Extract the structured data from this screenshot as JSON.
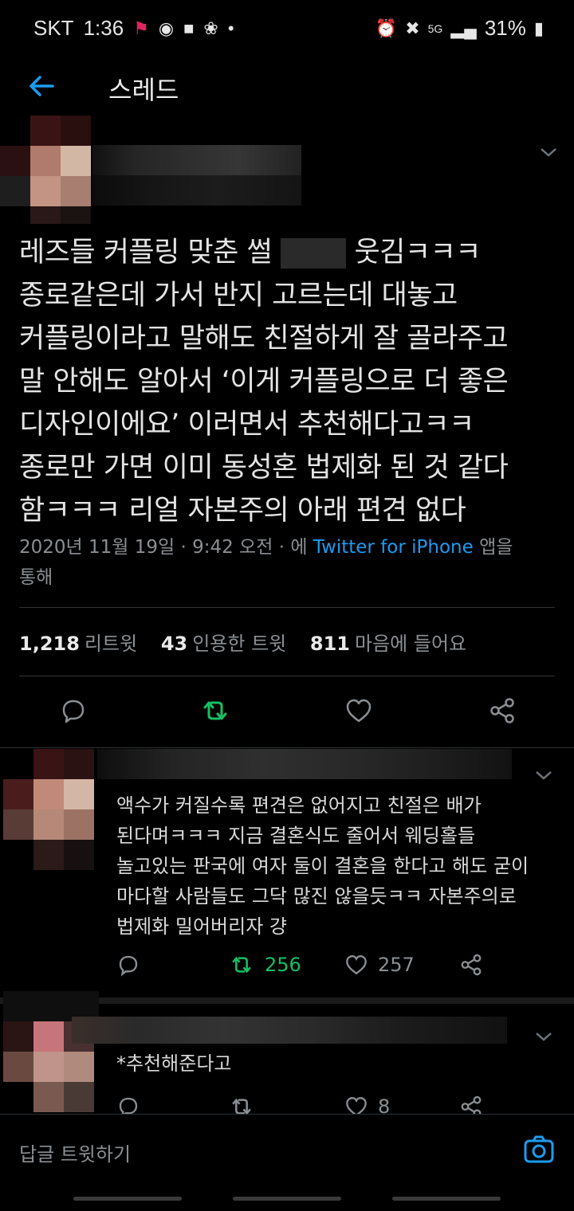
{
  "status": {
    "carrier": "SKT",
    "time": "1:36",
    "battery": "31%",
    "network": "5G"
  },
  "header": {
    "title": "스레드"
  },
  "tweet": {
    "text_lines": [
      "레즈들 커플링 맞춘 썰",
      "웃김ㅋㅋㅋ",
      "종로같은데 가서 반지 고르는데 대놓고",
      "커플링이라고 말해도 친절하게 잘 골라주고",
      "말 안해도 알아서 ‘이게 커플링으로 더 좋은",
      "디자인이에요’ 이러면서 추천해다고ㅋㅋ",
      "종로만 가면 이미 동성혼 법제화 된 것 같다",
      "함ㅋㅋㅋ 리얼 자본주의 아래 편견 없다"
    ],
    "meta_prefix": "2020년 11월 19일 · 9:42 오전 · 에 ",
    "meta_link": "Twitter for iPhone",
    "meta_suffix": " 앱을",
    "meta_line2": "통해",
    "retweets": "1,218",
    "retweets_label": "리트윗",
    "quotes": "43",
    "quotes_label": "인용한 트윗",
    "likes": "811",
    "likes_label": "마음에 들어요"
  },
  "replies": [
    {
      "lines": [
        "액수가 커질수록 편견은 없어지고 친절은 배가",
        "된다며ㅋㅋㅋ 지금 결혼식도 줄어서 웨딩홀들",
        "놀고있는 판국에 여자 둘이 결혼을 한다고 해도 굳이",
        "마다할 사람들도 그닥 많진 않을듯ㅋㅋ 자본주의로",
        "법제화 밀어버리자 걍"
      ],
      "retweets": "256",
      "likes": "257"
    },
    {
      "lines": [
        "*추천해준다고"
      ],
      "retweets": "",
      "likes": "8"
    }
  ],
  "composer": {
    "placeholder": "답글 트윗하기"
  },
  "colors": {
    "accent": "#1d9bf0",
    "retweet": "#17bf63",
    "muted": "#8b8f93"
  },
  "icons": [
    "back-arrow-icon",
    "chevron-down-icon",
    "reply-icon",
    "retweet-icon",
    "like-icon",
    "share-icon",
    "camera-icon"
  ]
}
